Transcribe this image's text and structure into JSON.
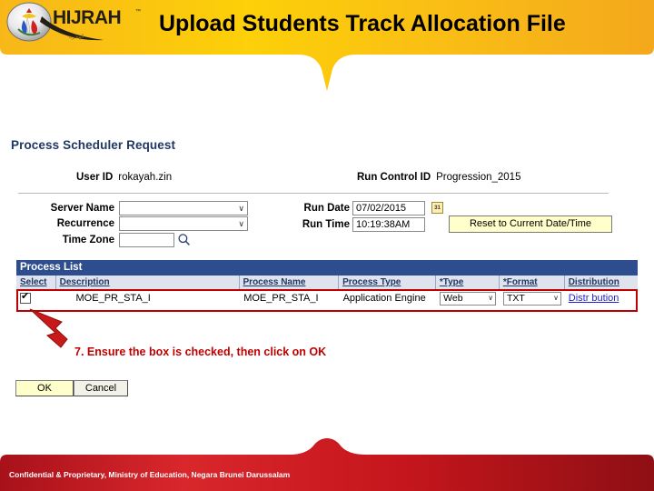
{
  "header": {
    "title": "Upload Students Track Allocation File",
    "logo_text": "HIJRAH",
    "logo_tagline": "",
    "banner_color": "#f5b61a",
    "banner_color_light": "#fcd211"
  },
  "form": {
    "section_title": "Process Scheduler Request",
    "user_id_label": "User ID",
    "user_id_value": "rokayah.zin",
    "run_control_label": "Run Control ID",
    "run_control_value": "Progression_2015",
    "server_name_label": "Server Name",
    "server_name_value": "",
    "recurrence_label": "Recurrence",
    "recurrence_value": "",
    "time_zone_label": "Time Zone",
    "time_zone_value": "",
    "run_date_label": "Run Date",
    "run_date_value": "07/02/2015",
    "run_time_label": "Run Time",
    "run_time_value": "10:19:38AM",
    "reset_button_label": "Reset to Current Date/Time",
    "calendar_icon_text": "31",
    "chevron": "∨"
  },
  "process_list": {
    "title": "Process List",
    "columns": [
      "Select",
      "Description",
      "Process Name",
      "Process Type",
      "*Type",
      "*Format",
      "Distribution"
    ],
    "row": {
      "selected": true,
      "description": "MOE_PR_STA_I",
      "process_name": "MOE_PR_STA_I",
      "process_type": "Application Engine",
      "type": "Web",
      "format": "TXT",
      "distribution_link": "Distr bution"
    },
    "header_color": "#2e4d8f",
    "highlight_color": "#c00000"
  },
  "callout": {
    "text": "7. Ensure the box is checked, then click on OK",
    "color": "#c00000"
  },
  "actions": {
    "ok_label": "OK",
    "cancel_label": "Cancel"
  },
  "footer": {
    "text": "Confidential & Proprietary, Ministry of Education, Negara Brunei Darussalam",
    "color": "#c1161c"
  }
}
